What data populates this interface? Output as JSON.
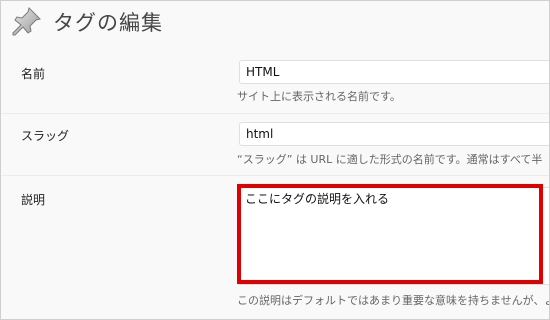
{
  "header": {
    "title": "タグの編集",
    "icon": "pushpin-icon"
  },
  "form": {
    "name": {
      "label": "名前",
      "value": "HTML",
      "description": "サイト上に表示される名前です。"
    },
    "slug": {
      "label": "スラッグ",
      "value": "html",
      "description": "“スラッグ” は URL に適した形式の名前です。通常はすべて半"
    },
    "description": {
      "label": "説明",
      "value": "ここにタグの説明を入れる",
      "help": "この説明はデフォルトではあまり重要な意味を持ちませんが、よ"
    }
  },
  "colors": {
    "highlight": "#e00000",
    "background": "#f9f9f9"
  }
}
